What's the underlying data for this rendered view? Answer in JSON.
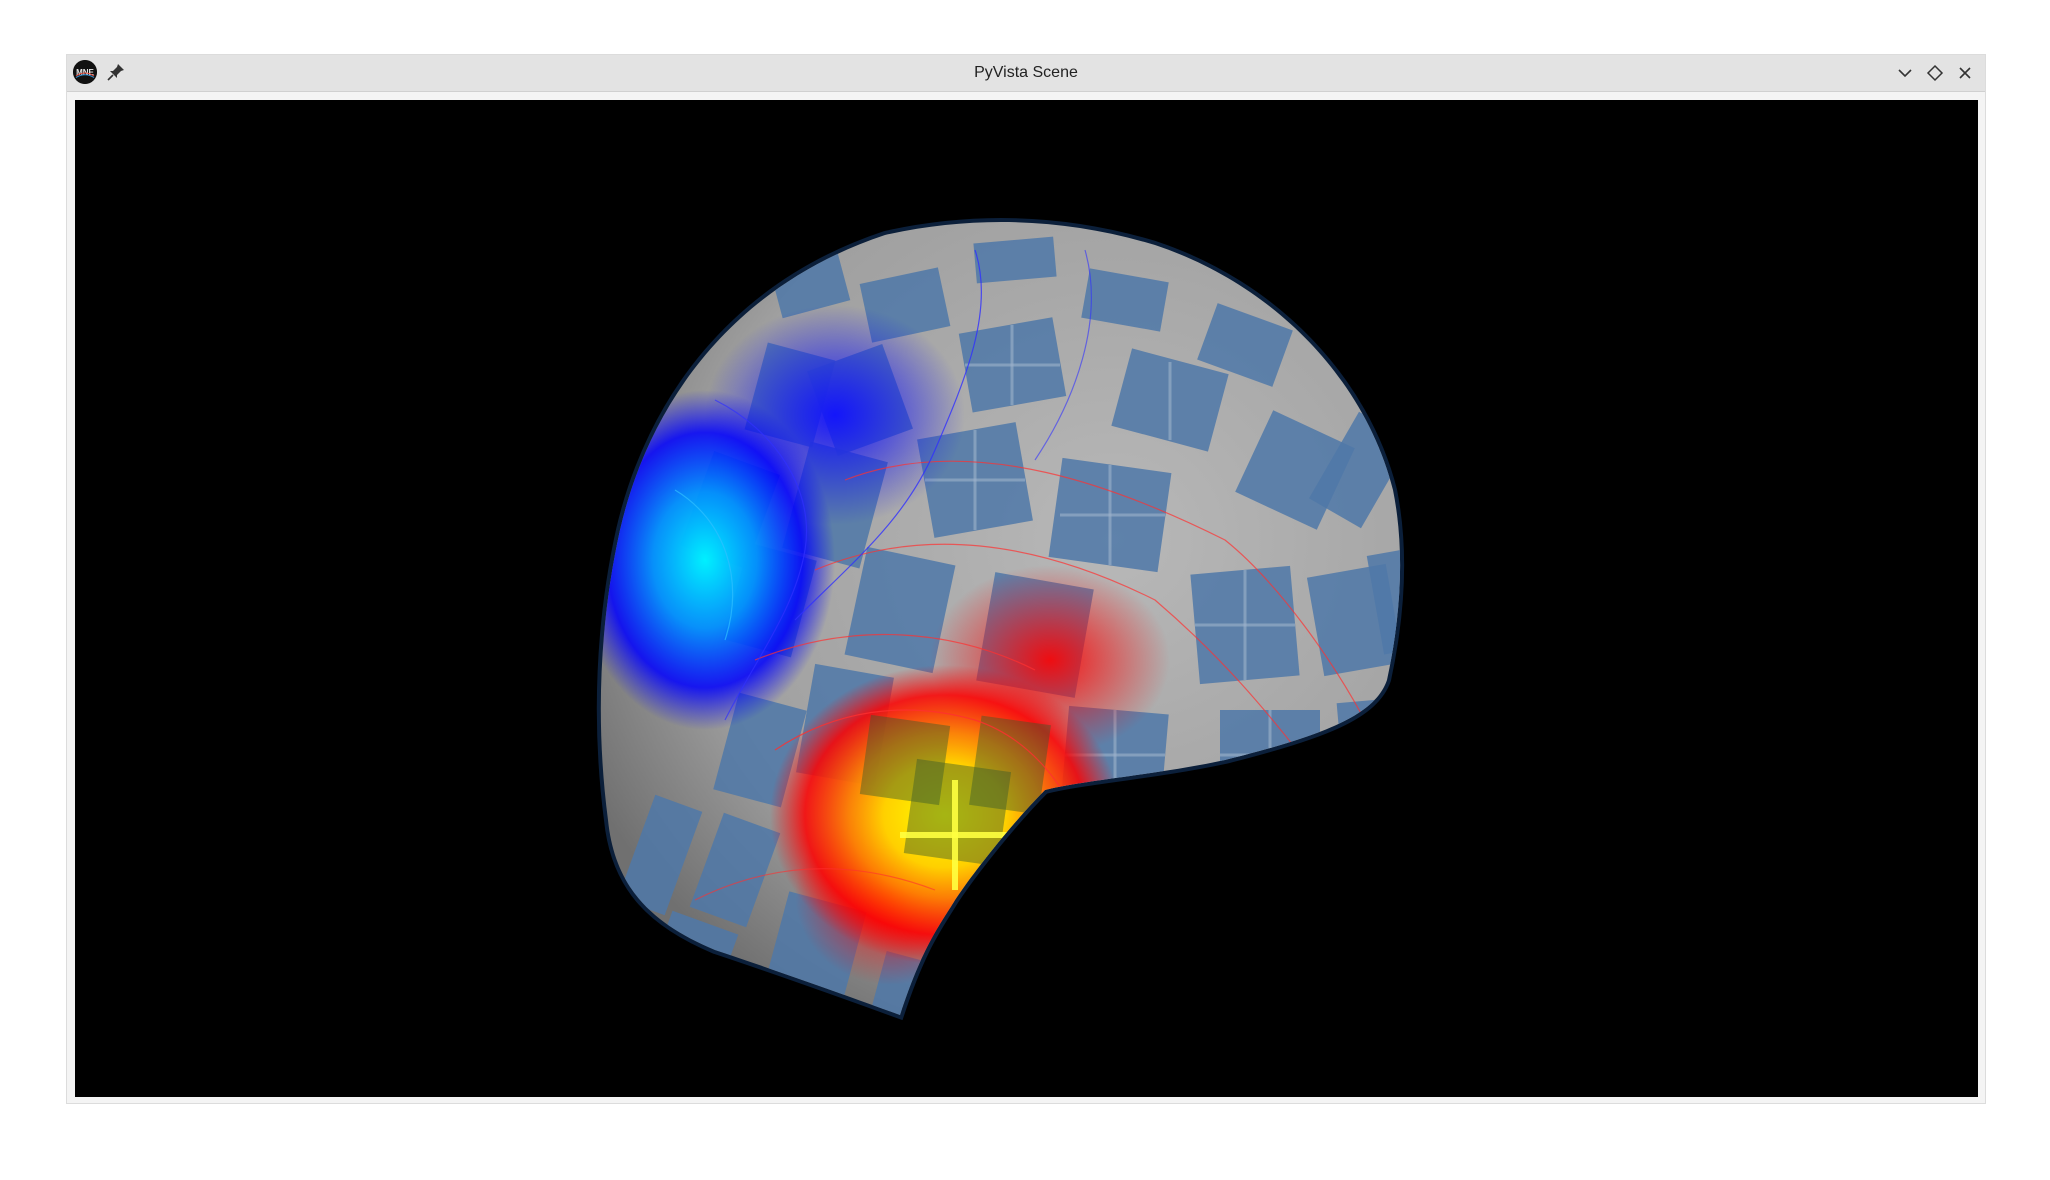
{
  "window": {
    "title": "PyVista Scene"
  },
  "titlebar": {
    "app_icon": "mne-logo-icon",
    "pin_icon": "pin-icon",
    "minimize_icon": "chevron-down-icon",
    "maximize_icon": "diamond-icon",
    "close_icon": "close-icon"
  },
  "scene": {
    "background_color": "#000000",
    "head_surface_color": "#a9a9a9",
    "sensor_patch_color": "#4f78a8",
    "colormap_high": [
      "#ff0000",
      "#ff8c00",
      "#ffff00"
    ],
    "colormap_low": [
      "#0000ff",
      "#00e5ff"
    ]
  }
}
